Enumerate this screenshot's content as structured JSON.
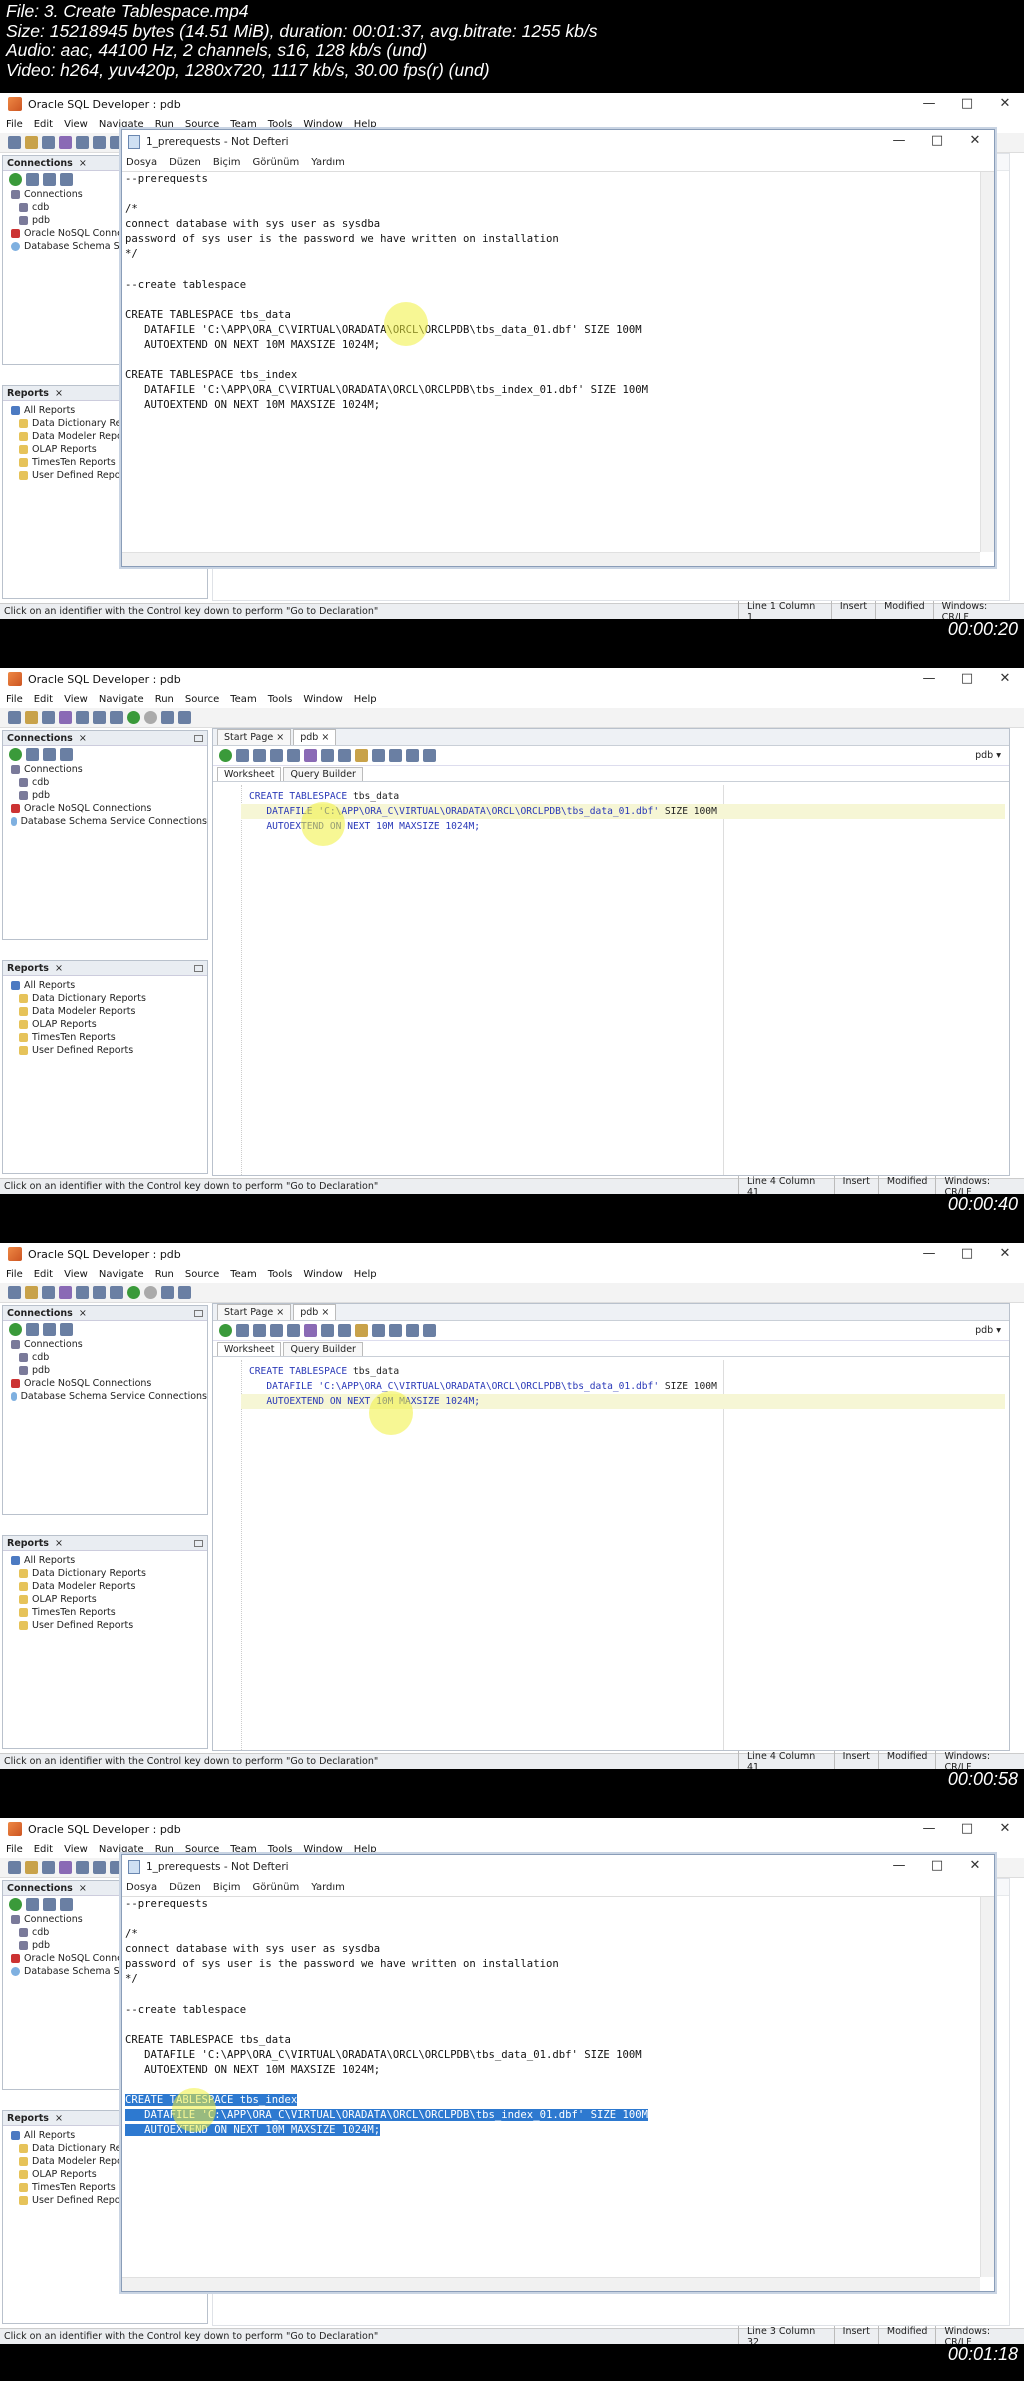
{
  "header": {
    "line1": "File: 3. Create Tablespace.mp4",
    "line2": "Size: 15218945 bytes (14.51 MiB), duration: 00:01:37, avg.bitrate: 1255 kb/s",
    "line3": "Audio: aac, 44100 Hz, 2 channels, s16, 128 kb/s (und)",
    "line4": "Video: h264, yuv420p, 1280x720, 1117 kb/s, 30.00 fps(r) (und)"
  },
  "app": {
    "title": "Oracle SQL Developer : pdb",
    "menu": [
      "File",
      "Edit",
      "View",
      "Navigate",
      "Run",
      "Source",
      "Team",
      "Tools",
      "Window",
      "Help"
    ],
    "connections_label": "Connections",
    "connections_tree": [
      "Connections",
      "cdb",
      "pdb",
      "Oracle NoSQL Connections",
      "Database Schema Service Connections"
    ],
    "connections_tree_short": [
      "Connections",
      "cdb",
      "pdb",
      "Oracle NoSQL Connecti",
      "Database Schema Servic"
    ],
    "reports_label": "Reports",
    "reports_tree": [
      "All Reports",
      "Data Dictionary Reports",
      "Data Modeler Reports",
      "OLAP Reports",
      "TimesTen Reports",
      "User Defined Reports"
    ],
    "reports_tree_short": [
      "All Reports",
      "Data Dictionary Rep",
      "Data Modeler Repo",
      "OLAP Reports",
      "TimesTen Reports",
      "User Defined Repor"
    ],
    "tab_start": "Start Page",
    "tab_pdb": "pdb",
    "worksheet_tab": "Worksheet",
    "query_builder_tab": "Query Builder",
    "conn_selector": "pdb",
    "status_msg": "Click on an identifier with the Control key down to perform \"Go to Declaration\"",
    "status_insert": "Insert",
    "status_modified": "Modified",
    "status_windows": "Windows: CR/LF"
  },
  "notepad": {
    "title": "1_prerequests - Not Defteri",
    "menu": [
      "Dosya",
      "Düzen",
      "Biçim",
      "Görünüm",
      "Yardım"
    ],
    "lines": [
      "--prerequests",
      "",
      "/*",
      "connect database with sys user as sysdba",
      "password of sys user is the password we have written on installation",
      "*/",
      "",
      "--create tablespace",
      "",
      "CREATE TABLESPACE tbs_data",
      "   DATAFILE 'C:\\APP\\ORA_C\\VIRTUAL\\ORADATA\\ORCL\\ORCLPDB\\tbs_data_01.dbf' SIZE 100M",
      "   AUTOEXTEND ON NEXT 10M MAXSIZE 1024M;",
      "",
      "CREATE TABLESPACE tbs_index",
      "   DATAFILE 'C:\\APP\\ORA_C\\VIRTUAL\\ORADATA\\ORCL\\ORCLPDB\\tbs_index_01.dbf' SIZE 100M",
      "   AUTOEXTEND ON NEXT 10M MAXSIZE 1024M;"
    ]
  },
  "worksheet_code": {
    "l1a": "CREATE TABLESPACE",
    "l1b": " tbs_data",
    "l2a": "   DATAFILE ",
    "l2b": "'C:\\APP\\ORA_C\\VIRTUAL\\ORADATA\\ORCL\\ORCLPDB\\tbs_data_01.dbf'",
    "l2c": " SIZE 100M",
    "l3": "   AUTOEXTEND ON NEXT 10M MAXSIZE 1024M;"
  },
  "frames": [
    {
      "timestamp": "00:00:20",
      "position": "Line 1 Column 1"
    },
    {
      "timestamp": "00:00:40",
      "position": "Line 4 Column 41"
    },
    {
      "timestamp": "00:00:58",
      "position": "Line 4 Column 41"
    },
    {
      "timestamp": "00:01:18",
      "position": "Line 3 Column 32"
    }
  ],
  "colors": {
    "selection": "#2d79d0",
    "keyword": "#2a39b8",
    "current_line": "#f6f6d5",
    "cursor_highlight": "#f0f03c"
  }
}
